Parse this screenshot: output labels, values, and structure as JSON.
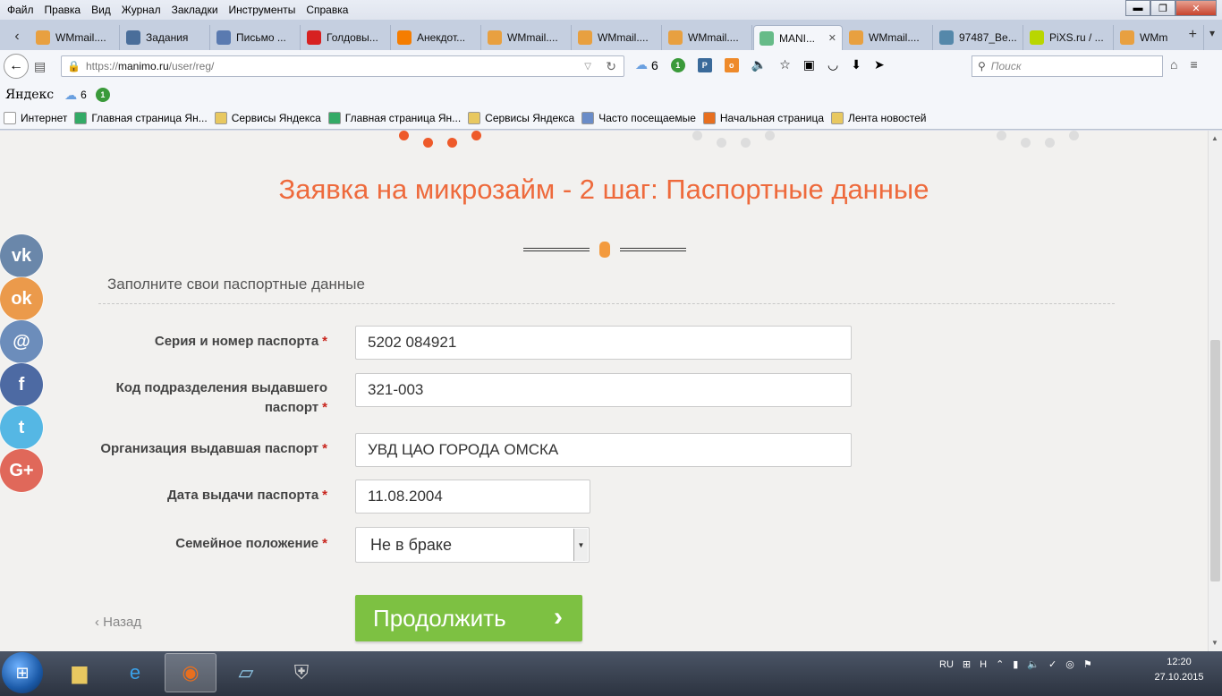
{
  "menu": {
    "items": [
      "Файл",
      "Правка",
      "Вид",
      "Журнал",
      "Закладки",
      "Инструменты",
      "Справка"
    ]
  },
  "tabs": [
    {
      "label": "WMmail....",
      "icon": "wmmail-icon",
      "color": "#e8a040"
    },
    {
      "label": "Задания",
      "icon": "vk-icon",
      "color": "#4a6e9a"
    },
    {
      "label": "Письмо ...",
      "icon": "mail-icon",
      "color": "#5a7ab0"
    },
    {
      "label": "Голдовы...",
      "icon": "youtube-icon",
      "color": "#d72121"
    },
    {
      "label": "Анекдот...",
      "icon": "blogger-icon",
      "color": "#f57d00"
    },
    {
      "label": "WMmail....",
      "icon": "wmmail-icon",
      "color": "#e8a040"
    },
    {
      "label": "WMmail....",
      "icon": "wmmail-icon",
      "color": "#e8a040"
    },
    {
      "label": "WMmail....",
      "icon": "wmmail-icon",
      "color": "#e8a040"
    },
    {
      "label": "MANI...",
      "icon": "manimo-icon",
      "color": "#66bb88",
      "active": true
    },
    {
      "label": "WMmail....",
      "icon": "wmmail-icon",
      "color": "#e8a040"
    },
    {
      "label": "97487_Be...",
      "icon": "image-icon",
      "color": "#5588aa"
    },
    {
      "label": "PiXS.ru / ...",
      "icon": "pixs-icon",
      "color": "#b9d600"
    },
    {
      "label": "WMm",
      "icon": "wmmail-icon",
      "color": "#e8a040"
    }
  ],
  "nav": {
    "url_prefix": "https://",
    "url_host": "manimo.ru",
    "url_path": "/user/reg/",
    "weather_count": "6",
    "badge_count": "1",
    "search_placeholder": "Поиск"
  },
  "yandex": {
    "logo": "Яндекс",
    "weather": "6",
    "badge": "1"
  },
  "bookmarks": [
    {
      "label": "Интернет",
      "icon": "page-icon",
      "color": "#ffffff"
    },
    {
      "label": "Главная страница Ян...",
      "icon": "globe-icon",
      "color": "#3a6"
    },
    {
      "label": "Сервисы Яндекса",
      "icon": "folder-icon",
      "color": "#e8c860"
    },
    {
      "label": "Главная страница Ян...",
      "icon": "globe-icon",
      "color": "#3a6"
    },
    {
      "label": "Сервисы Яндекса",
      "icon": "folder-icon",
      "color": "#e8c860"
    },
    {
      "label": "Часто посещаемые",
      "icon": "star-folder-icon",
      "color": "#6a8cc8"
    },
    {
      "label": "Начальная страница",
      "icon": "firefox-icon",
      "color": "#e76f1f"
    },
    {
      "label": "Лента новостей",
      "icon": "rss-icon",
      "color": "#e8c860"
    }
  ],
  "page": {
    "title": "Заявка на микрозайм - 2 шаг: Паспортные данные",
    "subtitle": "Заполните свои паспортные данные",
    "fields": {
      "passport_number": {
        "label": "Серия и номер паспорта",
        "value": "5202 084921"
      },
      "division_code": {
        "label_line1": "Код подразделения выдавшего",
        "label_line2": "паспорт",
        "value": "321-003"
      },
      "issuing_org": {
        "label": "Организация выдавшая паспорт",
        "value": "УВД ЦАО ГОРОДА ОМСКА"
      },
      "issue_date": {
        "label": "Дата выдачи паспорта",
        "value": "11.08.2004"
      },
      "marital_status": {
        "label": "Семейное положение",
        "value": "Не в браке"
      }
    },
    "required_mark": "*",
    "continue_label": "Продолжить",
    "back_label": "Назад"
  },
  "social": [
    {
      "name": "vk",
      "glyph": "vk",
      "color": "#6a87aa"
    },
    {
      "name": "odnoklassniki",
      "glyph": "ok",
      "color": "#eb9a4b"
    },
    {
      "name": "mail",
      "glyph": "@",
      "color": "#6c8dbb"
    },
    {
      "name": "facebook",
      "glyph": "f",
      "color": "#4d6aa3"
    },
    {
      "name": "twitter",
      "glyph": "t",
      "color": "#55b7e4"
    },
    {
      "name": "google-plus",
      "glyph": "G+",
      "color": "#e0685a"
    }
  ],
  "taskbar": {
    "lang": "RU",
    "time": "12:20",
    "date": "27.10.2015"
  },
  "colors": {
    "accent": "#ee6a3c",
    "button": "#7dc142",
    "required": "#c8241c"
  }
}
